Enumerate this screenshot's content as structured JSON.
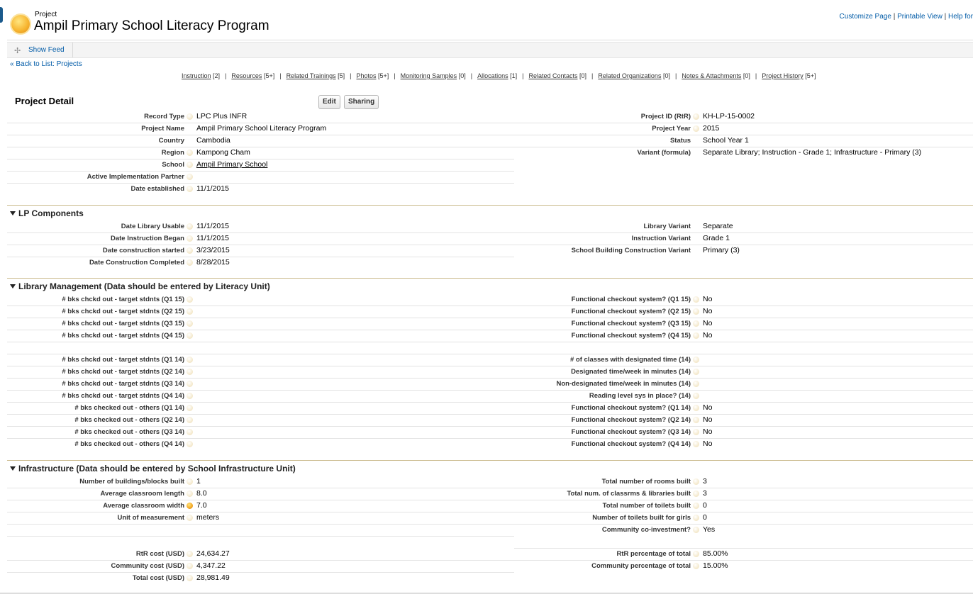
{
  "header": {
    "object_type": "Project",
    "title": "Ampil Primary School Literacy Program",
    "customize": "Customize Page",
    "printable": "Printable View",
    "help": "Help for"
  },
  "feed": {
    "show_feed": "Show Feed"
  },
  "back_link": "« Back to List: Projects",
  "related": [
    {
      "label": "Instruction",
      "count": "[2]"
    },
    {
      "label": "Resources",
      "count": "[5+]"
    },
    {
      "label": "Related Trainings",
      "count": "[5]"
    },
    {
      "label": "Photos",
      "count": "[5+]"
    },
    {
      "label": "Monitoring Samples",
      "count": "[0]"
    },
    {
      "label": "Allocations",
      "count": "[1]"
    },
    {
      "label": "Related Contacts",
      "count": "[0]"
    },
    {
      "label": "Related Organizations",
      "count": "[0]"
    },
    {
      "label": "Notes & Attachments",
      "count": "[0]"
    },
    {
      "label": "Project History",
      "count": "[5+]"
    }
  ],
  "detail": {
    "title": "Project Detail",
    "edit": "Edit",
    "sharing": "Sharing",
    "left": [
      {
        "label": "Record Type",
        "value": "LPC Plus INFR"
      },
      {
        "label": "Project Name",
        "value": "Ampil Primary School Literacy Program"
      },
      {
        "label": "Country",
        "value": "Cambodia"
      },
      {
        "label": "Region",
        "value": "Kampong Cham"
      },
      {
        "label": "School",
        "value": "Ampil Primary School"
      },
      {
        "label": "Active Implementation Partner",
        "value": ""
      },
      {
        "label": "Date established",
        "value": "11/1/2015"
      }
    ],
    "right": [
      {
        "label": "Project ID (RtR)",
        "value": "KH-LP-15-0002"
      },
      {
        "label": "Project Year",
        "value": "2015"
      },
      {
        "label": "Status",
        "value": "School Year 1"
      },
      {
        "label": "Variant (formula)",
        "value": "Separate Library; Instruction - Grade 1; Infrastructure - Primary (3)"
      }
    ]
  },
  "lp": {
    "title": "LP Components",
    "left": [
      {
        "label": "Date Library Usable",
        "value": "11/1/2015"
      },
      {
        "label": "Date Instruction Began",
        "value": "11/1/2015"
      },
      {
        "label": "Date construction started",
        "value": "3/23/2015"
      },
      {
        "label": "Date Construction Completed",
        "value": "8/28/2015"
      }
    ],
    "right": [
      {
        "label": "Library Variant",
        "value": "Separate"
      },
      {
        "label": "Instruction Variant",
        "value": "Grade 1"
      },
      {
        "label": "School Building Construction Variant",
        "value": "Primary (3)"
      }
    ]
  },
  "lib": {
    "title": "Library Management (Data should be entered by Literacy Unit)",
    "left1": [
      {
        "label": "# bks chckd out - target stdnts (Q1 15)",
        "value": ""
      },
      {
        "label": "# bks chckd out - target stdnts (Q2 15)",
        "value": ""
      },
      {
        "label": "# bks chckd out - target stdnts (Q3 15)",
        "value": ""
      },
      {
        "label": "# bks chckd out - target stdnts (Q4 15)",
        "value": ""
      }
    ],
    "right1": [
      {
        "label": "Functional checkout system? (Q1 15)",
        "value": "No"
      },
      {
        "label": "Functional checkout system? (Q2 15)",
        "value": "No"
      },
      {
        "label": "Functional checkout system? (Q3 15)",
        "value": "No"
      },
      {
        "label": "Functional checkout system? (Q4 15)",
        "value": "No"
      }
    ],
    "left2": [
      {
        "label": "# bks chckd out - target stdnts (Q1 14)",
        "value": ""
      },
      {
        "label": "# bks chckd out - target stdnts (Q2 14)",
        "value": ""
      },
      {
        "label": "# bks chckd out - target stdnts (Q3 14)",
        "value": ""
      },
      {
        "label": "# bks chckd out - target stdnts (Q4 14)",
        "value": ""
      },
      {
        "label": "# bks checked out - others (Q1 14)",
        "value": ""
      },
      {
        "label": "# bks checked out - others (Q2 14)",
        "value": ""
      },
      {
        "label": "# bks checked out - others (Q3 14)",
        "value": ""
      },
      {
        "label": "# bks checked out - others (Q4 14)",
        "value": ""
      }
    ],
    "right2": [
      {
        "label": "# of classes with designated time (14)",
        "value": ""
      },
      {
        "label": "Designated time/week in minutes (14)",
        "value": ""
      },
      {
        "label": "Non-designated time/week in minutes (14)",
        "value": ""
      },
      {
        "label": "Reading level sys in place? (14)",
        "value": ""
      },
      {
        "label": "Functional checkout system? (Q1 14)",
        "value": "No"
      },
      {
        "label": "Functional checkout system? (Q2 14)",
        "value": "No"
      },
      {
        "label": "Functional checkout system? (Q3 14)",
        "value": "No"
      },
      {
        "label": "Functional checkout system? (Q4 14)",
        "value": "No"
      }
    ]
  },
  "infra": {
    "title": "Infrastructure (Data should be entered by School Infrastructure Unit)",
    "left1": [
      {
        "label": "Number of buildings/blocks built",
        "value": "1"
      },
      {
        "label": "Average classroom length",
        "value": "8.0"
      },
      {
        "label": "Average classroom width",
        "value": "7.0"
      },
      {
        "label": "Unit of measurement",
        "value": "meters"
      }
    ],
    "right1": [
      {
        "label": "Total number of rooms built",
        "value": "3"
      },
      {
        "label": "Total num. of classrms & libraries built",
        "value": "3"
      },
      {
        "label": "Total number of toilets built",
        "value": "0"
      },
      {
        "label": "Number of toilets built for girls",
        "value": "0"
      },
      {
        "label": "Community co-investment?",
        "value": "Yes"
      }
    ],
    "left2": [
      {
        "label": "RtR cost (USD)",
        "value": "24,634.27"
      },
      {
        "label": "Community cost (USD)",
        "value": "4,347.22"
      },
      {
        "label": "Total cost (USD)",
        "value": "28,981.49"
      }
    ],
    "right2": [
      {
        "label": "RtR percentage of total",
        "value": "85.00%"
      },
      {
        "label": "Community percentage of total",
        "value": "15.00%"
      }
    ]
  }
}
